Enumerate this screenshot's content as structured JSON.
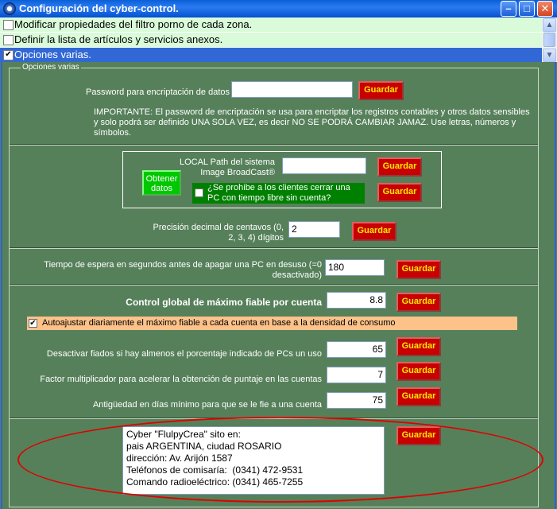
{
  "window": {
    "title": "Configuración del cyber-control.",
    "minimize_glyph": "–",
    "maximize_glyph": "□",
    "close_glyph": "✕"
  },
  "list": {
    "items": [
      {
        "label": "Modificar propiedades del filtro porno de cada zona.",
        "checked": false,
        "check_glyph": ""
      },
      {
        "label": "Definir la lista de artículos y servicios anexos.",
        "checked": false,
        "check_glyph": ""
      },
      {
        "label": "Opciones varias.",
        "checked": true,
        "check_glyph": "✔"
      }
    ],
    "scroll_up_glyph": "▲",
    "scroll_down_glyph": "▼"
  },
  "group": {
    "legend": "Opciones varias",
    "password_label": "Password para encriptación de datos",
    "password_value": "",
    "save_label": "Guardar",
    "important_note": "IMPORTANTE: El password de encriptación se usa para encriptar los registros contables y otros datos sensibles y solo podrá ser definido UNA SOLA VEZ, es decir NO SE PODRÁ CAMBIAR JAMAZ. Use letras, números y símbolos.",
    "obtain_data_label": "Obtener datos",
    "local_path_label": "LOCAL Path del sistema Image BroadCast®",
    "local_path_value": "",
    "prohibit_close_label": "¿Se prohibe a los clientes cerrar una PC con tiempo libre sin cuenta?",
    "decimal_label": "Precisión decimal de centavos (0, 2, 3, 4) dígitos",
    "decimal_value": "2",
    "wait_time_label": "Tiempo de espera en segundos antes de apagar una PC en desuso (=0 desactivado)",
    "wait_time_value": "180",
    "max_credit_label": "Control global de máximo fiable por cuenta",
    "max_credit_value": "8.8",
    "auto_adjust_label": "Autoajustar diariamente el máximo fiable a cada cuenta en base a la densidad de consumo",
    "auto_adjust_checked": true,
    "auto_adjust_glyph": "✔",
    "deactivate_label": "Desactivar fiados si hay almenos el porcentaje indicado de PCs un uso",
    "deactivate_value": "65",
    "multiplier_label": "Factor multiplicador para acelerar la obtención de puntaje en las cuentas",
    "multiplier_value": "7",
    "min_days_label": "Antigüedad en días mínimo para que se le fie a una cuenta",
    "min_days_value": "75",
    "footer_text": "Cyber \"FlulpyCrea\" sito en:\npais ARGENTINA, ciudad ROSARIO\ndirección: Av. Arijón 1587\nTeléfonos de comisaría:  (0341) 472-9531\nComando radioeléctrico: (0341) 465-7255"
  },
  "colors": {
    "panel_bg": "#56805a",
    "save_button_bg": "#c80000",
    "save_button_text": "#ffea00",
    "list_bg": "#d9fbd9",
    "selected_row_bg": "#3168d5",
    "annotation_ellipse": "#e00000"
  }
}
